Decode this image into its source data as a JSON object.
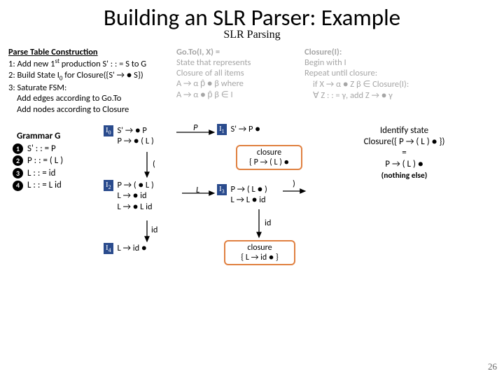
{
  "title": "Building an SLR Parser: Example",
  "subtitle": "SLR Parsing",
  "ptc": {
    "title": "Parse Table Construction",
    "step1": "1: Add new 1",
    "step1_sup": "st",
    "step1_rest": " production S' : : = S to G",
    "step2": "2: Build State I",
    "step2_sub": "0",
    "step2_rest": " for Closure({S' → ● S})",
    "step3": "3: Saturate FSM:",
    "step3a": "Add edges according to Go.To",
    "step3b": "Add nodes according to Closure"
  },
  "goto": {
    "title": "Go.To(I, X) =",
    "l1": "State that represents",
    "l2": "Closure of all items",
    "l3": "A → α p̂ ● β  where",
    "l4": "A → α ● p̂ β ∈ I"
  },
  "closure_def": {
    "title": "Closure(I):",
    "l1": "Begin with I",
    "l2": "Repeat until closure:",
    "l3": "if X → α ● Z β ∈ Closure(I):",
    "l4": "∀ Z : : = γ,  add  Z → ● γ"
  },
  "grammar": {
    "title": "Grammar G",
    "r1": "S'  : : = P",
    "r2": "P  : : = ( L )",
    "r3": "L  : : = id",
    "r4": "L  : : = L id"
  },
  "states": {
    "i0": {
      "label_i": "I",
      "label_n": "0",
      "line1": "S' → ● P",
      "line2": "P → ● ( L )"
    },
    "i1": {
      "label_i": "I",
      "label_n": "1",
      "line1": "S' → P ●"
    },
    "i2": {
      "label_i": "I",
      "label_n": "2",
      "line1": "P → ( ● L )",
      "line2": "L → ● id",
      "line3": "L → ● L id"
    },
    "i3": {
      "label_i": "I",
      "label_n": "3",
      "line1": "P → ( L ● )",
      "line2": "L → L ● id"
    },
    "i4": {
      "label_i": "I",
      "label_n": "4",
      "line1": "L → id ●"
    }
  },
  "closures": {
    "c1": {
      "title": "closure",
      "body": "{ P → ( L ) ●"
    },
    "c2": {
      "title": "closure",
      "body": "{ L → id ● }"
    }
  },
  "edges": {
    "P": "P",
    "open": "(",
    "L": "L",
    "close": ")",
    "id1": "id",
    "id2": "id"
  },
  "right_info": {
    "l1": "Identify state",
    "l2": "Closure({ P → ( L ) ● })",
    "l3": "=",
    "l4": "P → ( L ) ●",
    "l5": "(nothing else)"
  },
  "pagenum": "26"
}
